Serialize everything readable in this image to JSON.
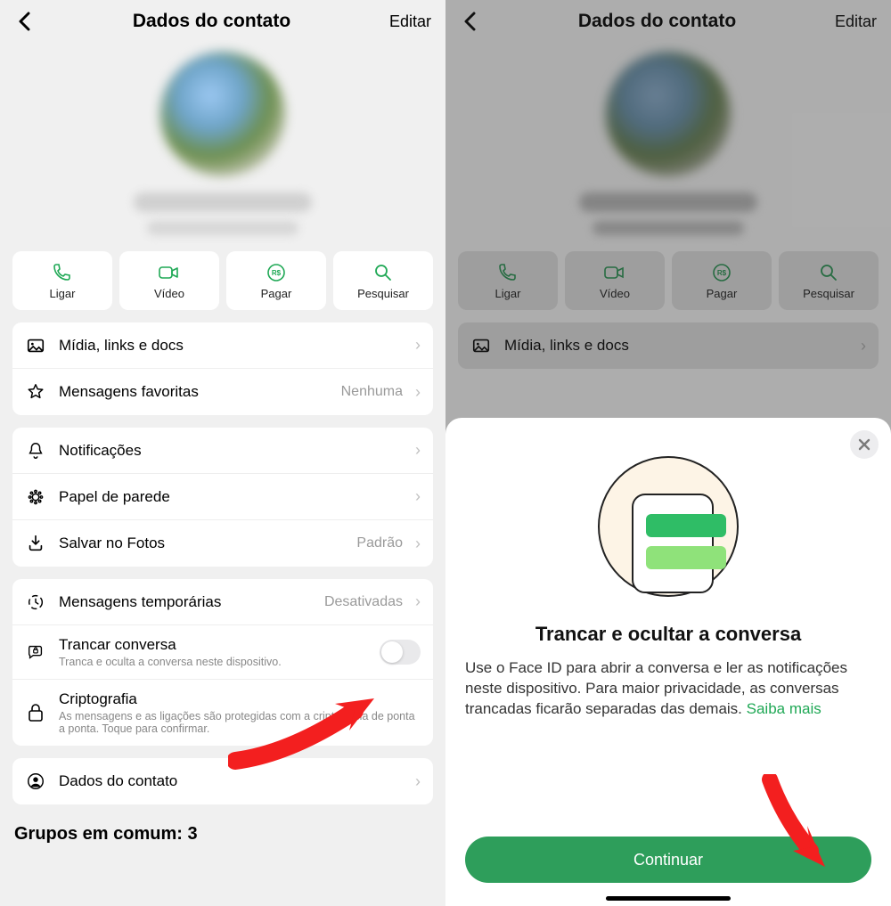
{
  "screen1": {
    "header": {
      "title": "Dados do contato",
      "edit": "Editar"
    },
    "actions": {
      "call": "Ligar",
      "video": "Vídeo",
      "pay": "Pagar",
      "search": "Pesquisar"
    },
    "rows": {
      "media": "Mídia, links e docs",
      "starred": "Mensagens favoritas",
      "starred_value": "Nenhuma",
      "notifications": "Notificações",
      "wallpaper": "Papel de parede",
      "save_photos": "Salvar no Fotos",
      "save_photos_value": "Padrão",
      "disappearing": "Mensagens temporárias",
      "disappearing_value": "Desativadas",
      "lock_chat": "Trancar conversa",
      "lock_chat_sub": "Tranca e oculta a conversa neste dispositivo.",
      "encryption": "Criptografia",
      "encryption_sub": "As mensagens e as ligações são protegidas com a criptografia de ponta a ponta. Toque para confirmar.",
      "contact_details": "Dados do contato"
    },
    "groups_label": "Grupos em comum: 3"
  },
  "screen2": {
    "header": {
      "title": "Dados do contato",
      "edit": "Editar"
    },
    "actions": {
      "call": "Ligar",
      "video": "Vídeo",
      "pay": "Pagar",
      "search": "Pesquisar"
    },
    "media_peek": "Mídia, links e docs",
    "sheet": {
      "title": "Trancar e ocultar a conversa",
      "body": "Use o Face ID para abrir a conversa e ler as notificações neste dispositivo. Para maior privacidade, as conversas trancadas ficarão separadas das demais. ",
      "learn_more": "Saiba mais",
      "continue": "Continuar"
    }
  },
  "colors": {
    "accent": "#1fa855",
    "button": "#2e9e5b"
  }
}
